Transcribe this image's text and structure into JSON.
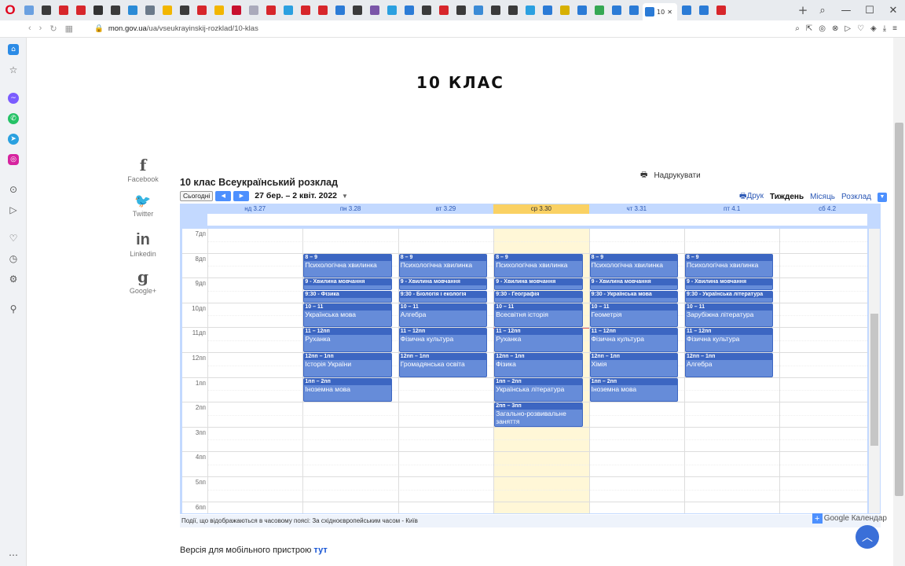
{
  "browser": {
    "active_tab_label": "10",
    "url_host": "mon.gov.ua",
    "url_path": "/ua/vseukrayinskij-rozklad/10-klas",
    "new_tab": "+",
    "tab_colors": [
      "#6aa0e0",
      "#3b3b3b",
      "#d7262b",
      "#d7262b",
      "#333",
      "#3b3b3b",
      "#2b8bd6",
      "#6b7a8a",
      "#f2b600",
      "#3b3b3b",
      "#d7262b",
      "#f2b600",
      "#c8102e",
      "#aab",
      "#d7262b",
      "#2ba0e0",
      "#d7262b",
      "#d7262b",
      "#2b7bd6",
      "#3b3b3b",
      "#7a55a8",
      "#2ba0e0",
      "#2b7bd6",
      "#3b3b3b",
      "#d7262b",
      "#3b3b3b",
      "#3b8bd6",
      "#3b3b3b",
      "#3b3b3b",
      "#2ba0e0",
      "#2b7bd6",
      "#d7b000",
      "#2b7bd6",
      "#35a853",
      "#2b7bd6",
      "#2b7bd6",
      "#2b7bd6",
      "#2b7bd6",
      "#d7262b"
    ]
  },
  "page": {
    "title": "10 КЛАС",
    "print_label": "Надрукувати",
    "mobile_text": "Версія для мобільного пристрою",
    "mobile_link": "тут"
  },
  "social": [
    {
      "icon": "f",
      "label": "Facebook"
    },
    {
      "icon": "🐦",
      "label": "Twitter"
    },
    {
      "icon": "in",
      "label": "Linkedin"
    },
    {
      "icon": "g",
      "label": "Google+"
    }
  ],
  "calendar": {
    "title": "10 клас Всеукраїнський розклад",
    "today_btn": "Сьогодні",
    "range": "27 бер. – 2 квіт. 2022",
    "print": "Друк",
    "views": [
      "Тиждень",
      "Місяць",
      "Розклад"
    ],
    "selected_view": "Тиждень",
    "days": [
      "нд 3.27",
      "пн 3.28",
      "вт 3.29",
      "ср 3.30",
      "чт 3.31",
      "пт 4.1",
      "сб 4.2"
    ],
    "today_index": 3,
    "hours": [
      "7дп",
      "8дп",
      "9дп",
      "10дп",
      "11дп",
      "12пп",
      "1пп",
      "2пп",
      "3пп",
      "4пп",
      "5пп",
      "6пп"
    ],
    "timezone_note": "Події, що відображаються в часовому поясі: За східноєвропейським часом - Київ",
    "brand": "Google Календар",
    "events": [
      {
        "day": 1,
        "start": 8,
        "end": 9,
        "time": "8 – 9",
        "name": "Психологічна хвилинка"
      },
      {
        "day": 1,
        "start": 9,
        "end": 9.5,
        "time": "9 - Хвилина мовчання",
        "name": ""
      },
      {
        "day": 1,
        "start": 9.5,
        "end": 10,
        "time": "9:30 - Фізика",
        "name": ""
      },
      {
        "day": 1,
        "start": 10,
        "end": 11,
        "time": "10 – 11",
        "name": "Українська мова"
      },
      {
        "day": 1,
        "start": 11,
        "end": 12,
        "time": "11 – 12пп",
        "name": "Руханка"
      },
      {
        "day": 1,
        "start": 12,
        "end": 13,
        "time": "12пп – 1пп",
        "name": "Історія України"
      },
      {
        "day": 1,
        "start": 13,
        "end": 14,
        "time": "1пп – 2пп",
        "name": "Іноземна мова"
      },
      {
        "day": 2,
        "start": 8,
        "end": 9,
        "time": "8 – 9",
        "name": "Психологічна хвилинка"
      },
      {
        "day": 2,
        "start": 9,
        "end": 9.5,
        "time": "9 - Хвилина мовчання",
        "name": ""
      },
      {
        "day": 2,
        "start": 9.5,
        "end": 10,
        "time": "9:30 - Біологія і екологія",
        "name": ""
      },
      {
        "day": 2,
        "start": 10,
        "end": 11,
        "time": "10 – 11",
        "name": "Алгебра"
      },
      {
        "day": 2,
        "start": 11,
        "end": 12,
        "time": "11 – 12пп",
        "name": "Фізична культура"
      },
      {
        "day": 2,
        "start": 12,
        "end": 13,
        "time": "12пп – 1пп",
        "name": "Громадянська освіта"
      },
      {
        "day": 3,
        "start": 8,
        "end": 9,
        "time": "8 – 9",
        "name": "Психологічна хвилинка"
      },
      {
        "day": 3,
        "start": 9,
        "end": 9.5,
        "time": "9 - Хвилина мовчання",
        "name": ""
      },
      {
        "day": 3,
        "start": 9.5,
        "end": 10,
        "time": "9:30 - Географія",
        "name": ""
      },
      {
        "day": 3,
        "start": 10,
        "end": 11,
        "time": "10 – 11",
        "name": "Всесвітня історія"
      },
      {
        "day": 3,
        "start": 11,
        "end": 12,
        "time": "11 – 12пп",
        "name": "Руханка"
      },
      {
        "day": 3,
        "start": 12,
        "end": 13,
        "time": "12пп – 1пп",
        "name": "Фізика"
      },
      {
        "day": 3,
        "start": 13,
        "end": 14,
        "time": "1пп – 2пп",
        "name": "Українська література"
      },
      {
        "day": 3,
        "start": 14,
        "end": 15,
        "time": "2пп – 3пп",
        "name": "Загально-розвивальне заняття"
      },
      {
        "day": 4,
        "start": 8,
        "end": 9,
        "time": "8 – 9",
        "name": "Психологічна хвилинка"
      },
      {
        "day": 4,
        "start": 9,
        "end": 9.5,
        "time": "9 - Хвилина мовчання",
        "name": ""
      },
      {
        "day": 4,
        "start": 9.5,
        "end": 10,
        "time": "9:30 - Українська мова",
        "name": ""
      },
      {
        "day": 4,
        "start": 10,
        "end": 11,
        "time": "10 – 11",
        "name": "Геометрія"
      },
      {
        "day": 4,
        "start": 11,
        "end": 12,
        "time": "11 – 12пп",
        "name": "Фізична культура"
      },
      {
        "day": 4,
        "start": 12,
        "end": 13,
        "time": "12пп – 1пп",
        "name": "Хімія"
      },
      {
        "day": 4,
        "start": 13,
        "end": 14,
        "time": "1пп – 2пп",
        "name": "Іноземна мова"
      },
      {
        "day": 5,
        "start": 8,
        "end": 9,
        "time": "8 – 9",
        "name": "Психологічна хвилинка"
      },
      {
        "day": 5,
        "start": 9,
        "end": 9.5,
        "time": "9 - Хвилина мовчання",
        "name": ""
      },
      {
        "day": 5,
        "start": 9.5,
        "end": 10,
        "time": "9:30 - Українська література",
        "name": ""
      },
      {
        "day": 5,
        "start": 10,
        "end": 11,
        "time": "10 – 11",
        "name": "Зарубіжна література"
      },
      {
        "day": 5,
        "start": 11,
        "end": 12,
        "time": "11 – 12пп",
        "name": "Фізична культура"
      },
      {
        "day": 5,
        "start": 12,
        "end": 13,
        "time": "12пп – 1пп",
        "name": "Алгебра"
      }
    ]
  }
}
